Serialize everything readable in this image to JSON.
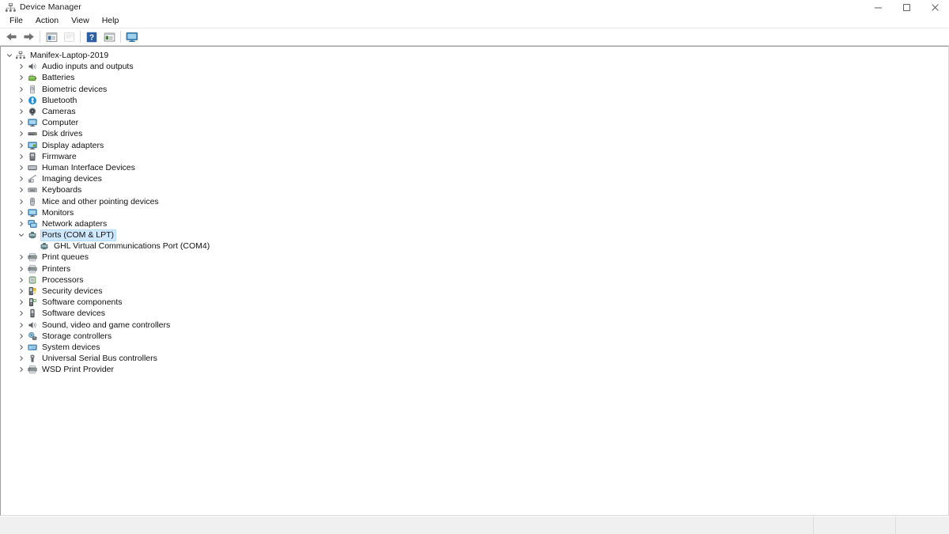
{
  "window": {
    "title": "Device Manager",
    "icon": "device-manager-icon",
    "controls": {
      "minimize": "minimize-icon",
      "maximize": "maximize-icon",
      "close": "close-icon"
    }
  },
  "menubar": {
    "items": [
      {
        "label": "File",
        "name": "menu-file"
      },
      {
        "label": "Action",
        "name": "menu-action"
      },
      {
        "label": "View",
        "name": "menu-view"
      },
      {
        "label": "Help",
        "name": "menu-help"
      }
    ]
  },
  "toolbar": {
    "buttons": [
      {
        "name": "back-button",
        "icon": "back-arrow-icon",
        "enabled": true
      },
      {
        "name": "forward-button",
        "icon": "forward-arrow-icon",
        "enabled": true
      },
      {
        "name": "properties-button",
        "icon": "properties-icon",
        "enabled": true
      },
      {
        "name": "update-driver-button",
        "icon": "update-driver-icon",
        "enabled": false
      },
      {
        "name": "help-button",
        "icon": "help-question-icon",
        "enabled": true
      },
      {
        "name": "show-hidden-button",
        "icon": "show-hidden-icon",
        "enabled": true
      },
      {
        "name": "scan-hardware-button",
        "icon": "scan-monitor-icon",
        "enabled": true
      }
    ]
  },
  "tree": {
    "root": {
      "label": "Manifex-Laptop-2019",
      "icon": "computer-root-icon",
      "expanded": true,
      "depth": 0,
      "selected": false
    },
    "nodes": [
      {
        "label": "Audio inputs and outputs",
        "icon": "speaker-icon",
        "expanded": false,
        "depth": 1,
        "selected": false
      },
      {
        "label": "Batteries",
        "icon": "battery-icon",
        "expanded": false,
        "depth": 1,
        "selected": false
      },
      {
        "label": "Biometric devices",
        "icon": "fingerprint-icon",
        "expanded": false,
        "depth": 1,
        "selected": false
      },
      {
        "label": "Bluetooth",
        "icon": "bluetooth-icon",
        "expanded": false,
        "depth": 1,
        "selected": false
      },
      {
        "label": "Cameras",
        "icon": "camera-icon",
        "expanded": false,
        "depth": 1,
        "selected": false
      },
      {
        "label": "Computer",
        "icon": "monitor-icon",
        "expanded": false,
        "depth": 1,
        "selected": false
      },
      {
        "label": "Disk drives",
        "icon": "disk-drive-icon",
        "expanded": false,
        "depth": 1,
        "selected": false
      },
      {
        "label": "Display adapters",
        "icon": "display-adapter-icon",
        "expanded": false,
        "depth": 1,
        "selected": false
      },
      {
        "label": "Firmware",
        "icon": "firmware-chip-icon",
        "expanded": false,
        "depth": 1,
        "selected": false
      },
      {
        "label": "Human Interface Devices",
        "icon": "hid-icon",
        "expanded": false,
        "depth": 1,
        "selected": false
      },
      {
        "label": "Imaging devices",
        "icon": "imaging-device-icon",
        "expanded": false,
        "depth": 1,
        "selected": false
      },
      {
        "label": "Keyboards",
        "icon": "keyboard-icon",
        "expanded": false,
        "depth": 1,
        "selected": false
      },
      {
        "label": "Mice and other pointing devices",
        "icon": "mouse-icon",
        "expanded": false,
        "depth": 1,
        "selected": false
      },
      {
        "label": "Monitors",
        "icon": "monitor-icon",
        "expanded": false,
        "depth": 1,
        "selected": false
      },
      {
        "label": "Network adapters",
        "icon": "network-adapter-icon",
        "expanded": false,
        "depth": 1,
        "selected": false
      },
      {
        "label": "Ports (COM & LPT)",
        "icon": "port-icon",
        "expanded": true,
        "depth": 1,
        "selected": true
      },
      {
        "label": "GHL Virtual Communications Port (COM4)",
        "icon": "port-icon",
        "expanded": null,
        "depth": 2,
        "selected": false
      },
      {
        "label": "Print queues",
        "icon": "printer-queue-icon",
        "expanded": false,
        "depth": 1,
        "selected": false
      },
      {
        "label": "Printers",
        "icon": "printer-queue-icon",
        "expanded": false,
        "depth": 1,
        "selected": false
      },
      {
        "label": "Processors",
        "icon": "processor-icon",
        "expanded": false,
        "depth": 1,
        "selected": false
      },
      {
        "label": "Security devices",
        "icon": "security-device-icon",
        "expanded": false,
        "depth": 1,
        "selected": false
      },
      {
        "label": "Software components",
        "icon": "software-component-icon",
        "expanded": false,
        "depth": 1,
        "selected": false
      },
      {
        "label": "Software devices",
        "icon": "software-device-icon",
        "expanded": false,
        "depth": 1,
        "selected": false
      },
      {
        "label": "Sound, video and game controllers",
        "icon": "speaker-icon",
        "expanded": false,
        "depth": 1,
        "selected": false
      },
      {
        "label": "Storage controllers",
        "icon": "storage-controller-icon",
        "expanded": false,
        "depth": 1,
        "selected": false
      },
      {
        "label": "System devices",
        "icon": "system-device-icon",
        "expanded": false,
        "depth": 1,
        "selected": false
      },
      {
        "label": "Universal Serial Bus controllers",
        "icon": "usb-controller-icon",
        "expanded": false,
        "depth": 1,
        "selected": false
      },
      {
        "label": "WSD Print Provider",
        "icon": "printer-queue-icon",
        "expanded": false,
        "depth": 1,
        "selected": false
      }
    ]
  },
  "statusbar": {
    "main_text": "",
    "cell_a_text": "",
    "cell_b_text": ""
  },
  "colors": {
    "selection_fill": "#cde8ff",
    "selection_border": "#b6dcfb",
    "text": "#111111",
    "panel_border": "#9c9c9c",
    "statusbar_bg": "#f0f0f0",
    "bluetooth_blue": "#1a8fd8",
    "battery_green": "#5aa832",
    "help_blue": "#2e5fa3"
  }
}
